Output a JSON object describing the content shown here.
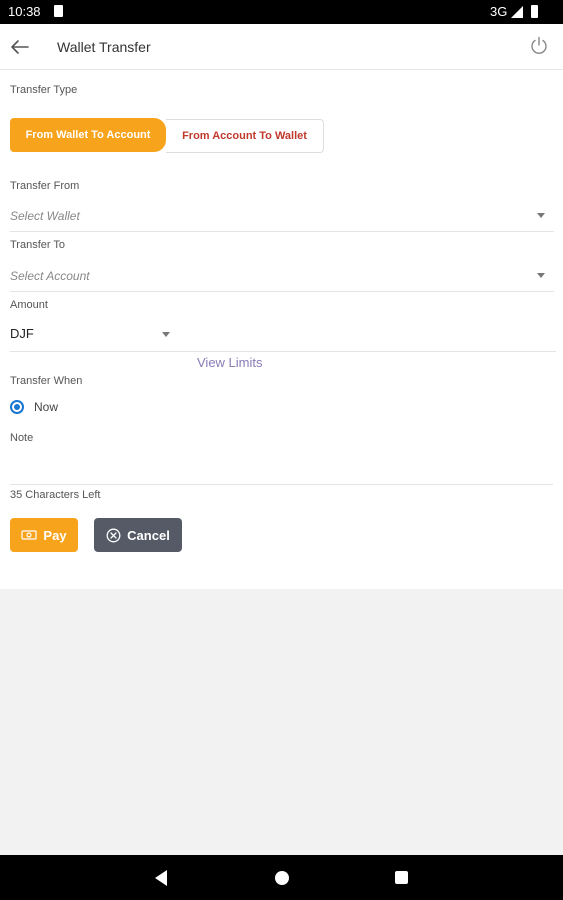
{
  "status_bar": {
    "time": "10:38",
    "network": "3G"
  },
  "header": {
    "title": "Wallet Transfer"
  },
  "form": {
    "transfer_type_label": "Transfer Type",
    "type_options": [
      "From Wallet To Account",
      "From Account To Wallet"
    ],
    "selected_type": "From Wallet To Account",
    "transfer_from_label": "Transfer From",
    "transfer_from_value": "Select Wallet",
    "transfer_to_label": "Transfer To",
    "transfer_to_value": "Select Account",
    "amount_label": "Amount",
    "currency": "DJF",
    "view_limits": "View Limits",
    "transfer_when_label": "Transfer When",
    "transfer_when_option": "Now",
    "note_label": "Note",
    "chars_left": "35 Characters Left"
  },
  "buttons": {
    "pay": "Pay",
    "cancel": "Cancel"
  },
  "colors": {
    "accent": "#f7a31c",
    "secondary_text": "#c0392b",
    "radio": "#1976d2",
    "cancel_bg": "#555a66",
    "link": "#8a7bb5"
  }
}
